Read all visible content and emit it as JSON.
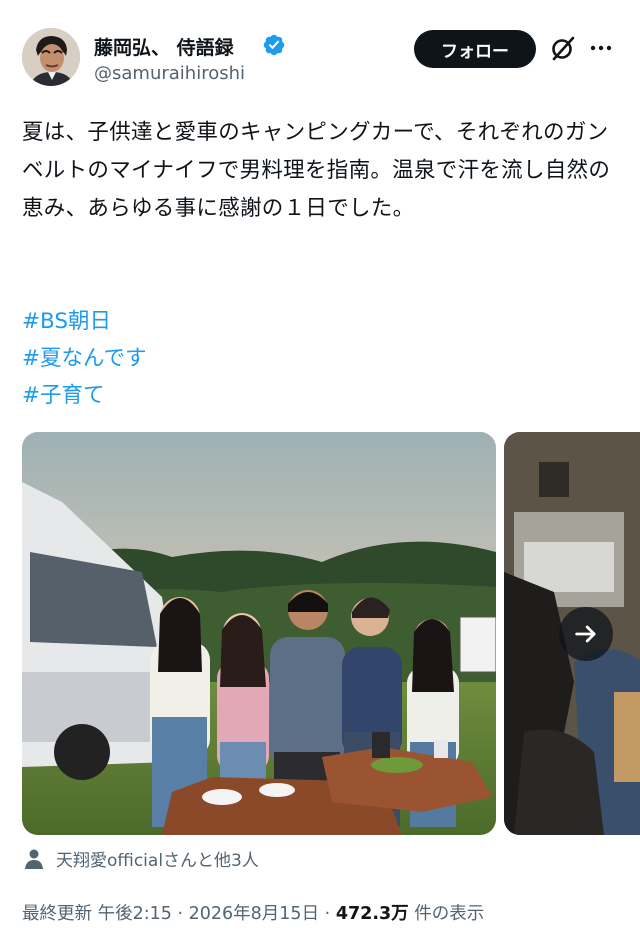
{
  "author": {
    "name": "藤岡弘、 侍語録",
    "handle": "@samuraihiroshi",
    "verified": true
  },
  "follow_button": {
    "label": "フォロー"
  },
  "tweet": {
    "text": "夏は、子供達と愛車のキャンピングカーで、それぞれのガンベルトのマイナイフで男料理を指南。温泉で汗を流し自然の恵み、あらゆる事に感謝の１日でした。",
    "hashtags": [
      "#BS朝日",
      "#夏なんです",
      "#子育て"
    ]
  },
  "tagged": {
    "text": "天翔愛officialさんと他3人"
  },
  "meta": {
    "prefix": "最終更新",
    "time": "午後2:15",
    "separator": "·",
    "date": "2026年8月15日",
    "views": "472.3万",
    "views_suffix": "件の表示"
  },
  "colors": {
    "accent": "#1d9bf0",
    "text": "#0f1419",
    "secondary": "#536471",
    "follow_bg": "#0f1419"
  },
  "icons": [
    "verified-badge-icon",
    "grok-icon",
    "more-icon",
    "next-arrow-icon",
    "person-icon"
  ]
}
